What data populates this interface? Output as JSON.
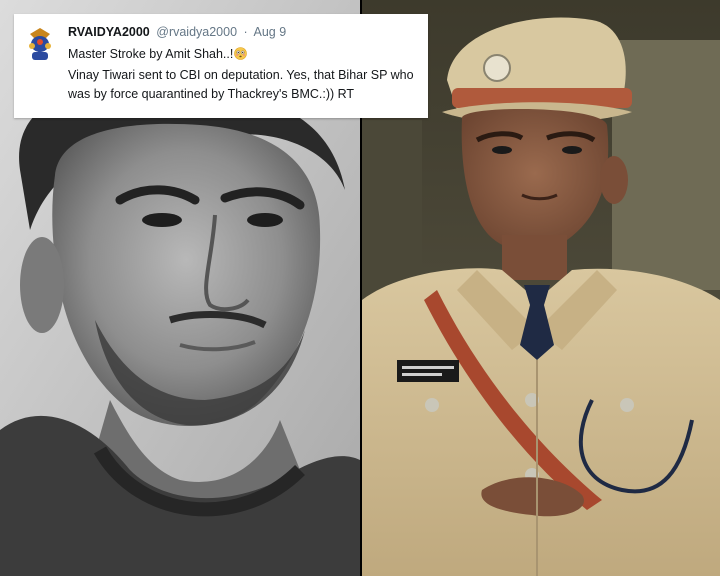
{
  "tweet": {
    "display_name": "RVAIDYA2000",
    "handle": "@rvaidya2000",
    "separator": "·",
    "date": "Aug 9",
    "line1": "Master Stroke by Amit Shah..!",
    "line2": "Vinay Tiwari sent to CBI on deputation. Yes, that Bihar SP who was by force quarantined by Thackrey's BMC.:)) RT",
    "emoji_icon": "flushed-face-icon"
  },
  "photos": {
    "left_icon": "man-portrait-photo",
    "right_icon": "police-officer-photo"
  }
}
